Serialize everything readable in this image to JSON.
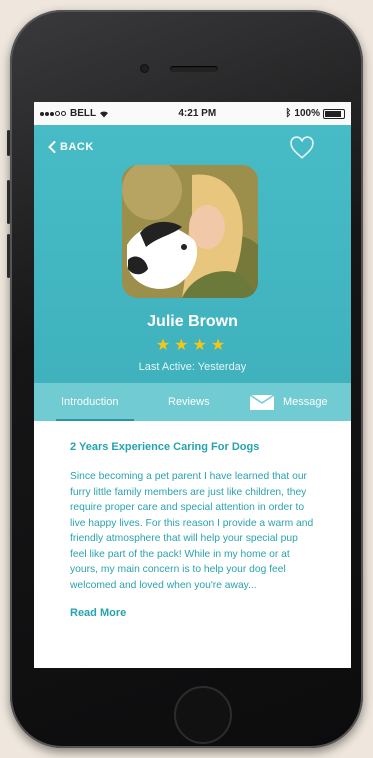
{
  "status_bar": {
    "carrier": "BELL",
    "time": "4:21 PM",
    "battery": "100%"
  },
  "header": {
    "back_label": "BACK",
    "favorite_icon": "heart-outline-icon"
  },
  "profile": {
    "name": "Julie Brown",
    "rating": 4,
    "stars": "★★★★",
    "last_active": "Last Active: Yesterday"
  },
  "tabs": [
    {
      "label": "Introduction",
      "active": true
    },
    {
      "label": "Reviews",
      "active": false
    },
    {
      "label": "Message",
      "active": false
    }
  ],
  "content": {
    "heading": "2 Years Experience Caring For Dogs",
    "body": "Since becoming a pet parent I have learned that our furry little family members are just like children, they require proper care and special attention in order to live happy lives. For this reason I provide a warm and friendly atmosphere that will help your special pup feel like part of the pack! While in my home or at yours, my main concern is to help your dog feel welcomed and loved when you're away...",
    "read_more": "Read More"
  },
  "colors": {
    "primary": "#47bbc6",
    "tab_bar": "#71cbd2",
    "accent_text": "#2aa3ad",
    "star": "#f5c518"
  }
}
